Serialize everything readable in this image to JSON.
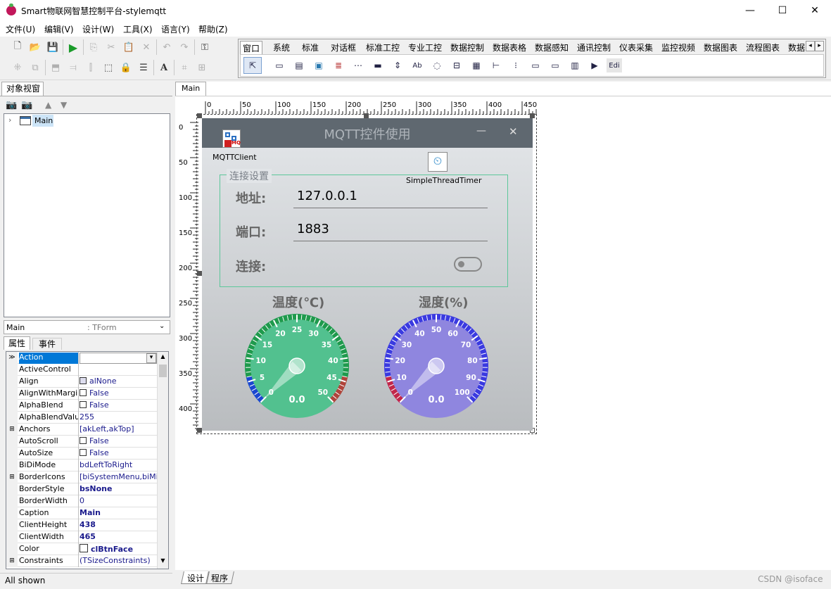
{
  "app": {
    "title": "Smart物联网智慧控制平台-stylemqtt",
    "min": "—",
    "max": "☐",
    "close": "✕"
  },
  "menu": [
    "文件(U)",
    "编辑(V)",
    "设计(W)",
    "工具(X)",
    "语言(Y)",
    "帮助(Z)"
  ],
  "palette": {
    "tabs": [
      "窗口",
      "系统",
      "标准",
      "对话框",
      "标准工控",
      "专业工控",
      "数据控制",
      "数据表格",
      "数据感知",
      "通讯控制",
      "仪表采集",
      "监控视频",
      "数据图表",
      "流程图表",
      "数据"
    ],
    "nav_left": "◂",
    "nav_right": "▸",
    "last_icon_label": "Edi"
  },
  "object_view": {
    "tab": "对象视窗",
    "tree_root": "Main",
    "combo_name": "Main",
    "combo_type": ": TForm",
    "tabs": [
      "属性",
      "事件"
    ]
  },
  "properties": [
    {
      "name": "Action",
      "value": "",
      "selected": true
    },
    {
      "name": "ActiveControl",
      "value": ""
    },
    {
      "name": "Align",
      "value": "alNone",
      "icon": true
    },
    {
      "name": "AlignWithMargins",
      "value": "False",
      "check": true
    },
    {
      "name": "AlphaBlend",
      "value": "False",
      "check": true
    },
    {
      "name": "AlphaBlendValue",
      "value": "255"
    },
    {
      "name": "Anchors",
      "value": "[akLeft,akTop]",
      "expand": true
    },
    {
      "name": "AutoScroll",
      "value": "False",
      "check": true
    },
    {
      "name": "AutoSize",
      "value": "False",
      "check": true
    },
    {
      "name": "BiDiMode",
      "value": "bdLeftToRight"
    },
    {
      "name": "BorderIcons",
      "value": "[biSystemMenu,biMinimize]",
      "expand": true
    },
    {
      "name": "BorderStyle",
      "value": "bsNone",
      "bold": true
    },
    {
      "name": "BorderWidth",
      "value": "0"
    },
    {
      "name": "Caption",
      "value": "Main",
      "bold": true
    },
    {
      "name": "ClientHeight",
      "value": "438",
      "bold": true
    },
    {
      "name": "ClientWidth",
      "value": "465",
      "bold": true
    },
    {
      "name": "Color",
      "value": "clBtnFace",
      "bold": true,
      "swatch": true
    },
    {
      "name": "Constraints",
      "value": "(TSizeConstraints)",
      "expand": true
    }
  ],
  "status": "All shown",
  "designer": {
    "tab": "Main",
    "ruler_h": [
      "0",
      "50",
      "100",
      "150",
      "200",
      "250",
      "300",
      "350",
      "400",
      "450"
    ],
    "ruler_v": [
      "0",
      "50",
      "100",
      "150",
      "200",
      "250",
      "300",
      "350",
      "400"
    ],
    "bottom_tabs": [
      "设计",
      "程序"
    ],
    "watermark": "CSDN @isoface"
  },
  "form": {
    "title": "MQTT控件使用",
    "min": "—",
    "close": "✕",
    "mqtt_label": "MQTTClient",
    "mqtt_icon_text": "MQ",
    "timer_label": "SimpleThreadTimer",
    "group_title": "连接设置",
    "addr_label": "地址:",
    "addr_value": "127.0.0.1",
    "port_label": "端口:",
    "port_value": "1883",
    "connect_label": "连接:",
    "connected": false
  },
  "gauges": [
    {
      "title": "温度(℃)",
      "value_text": "0.0",
      "min": 0,
      "max": 50,
      "value": 0,
      "ticks": [
        "0",
        "5",
        "10",
        "15",
        "20",
        "25",
        "30",
        "35",
        "40",
        "45",
        "50"
      ],
      "face": "#52c18f",
      "rim": "#1f9a4d",
      "low": "#1b47d0",
      "high": "#b0443b"
    },
    {
      "title": "湿度(%)",
      "value_text": "0.0",
      "min": 0,
      "max": 100,
      "value": 0,
      "ticks": [
        "0",
        "10",
        "20",
        "30",
        "40",
        "50",
        "60",
        "70",
        "80",
        "90",
        "100"
      ],
      "face": "#8f86df",
      "rim": "#3a3ae0",
      "low": "#c2264a",
      "high": "#3a3ae0"
    }
  ]
}
